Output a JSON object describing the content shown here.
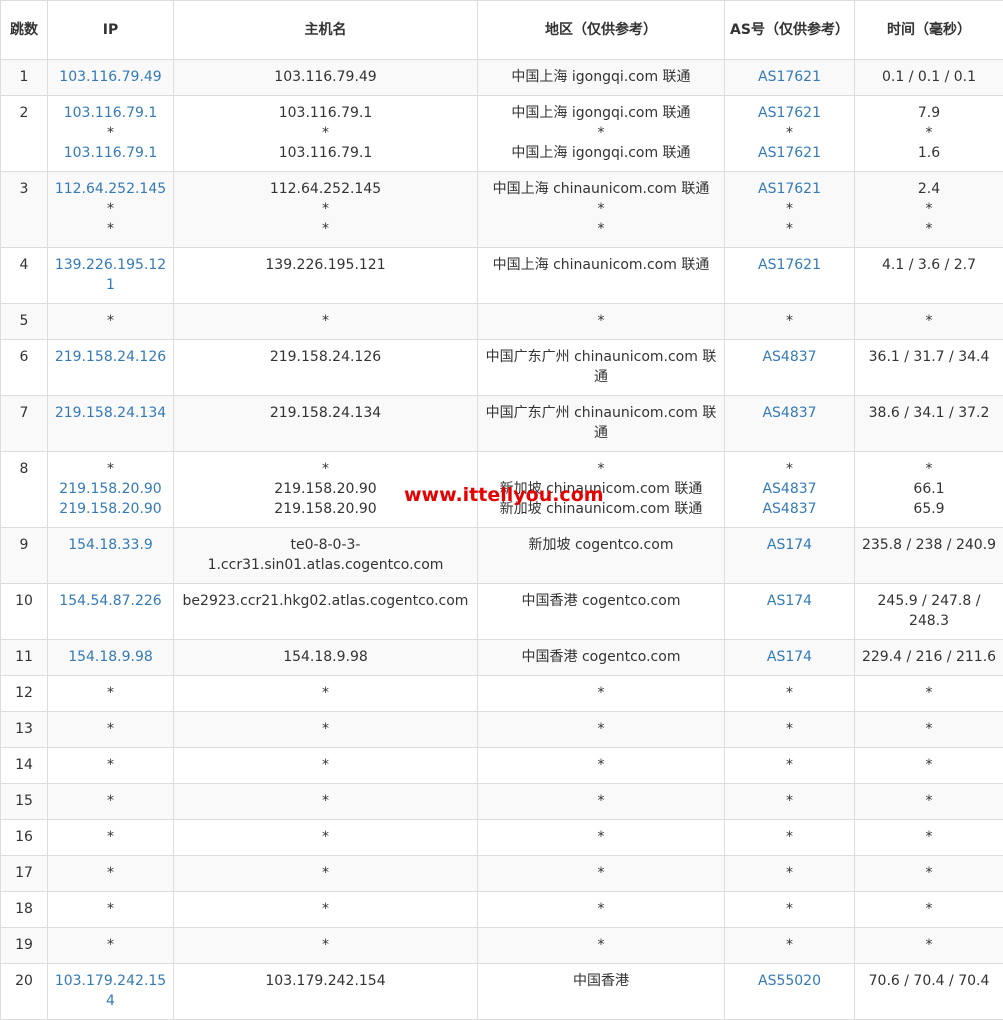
{
  "headers": {
    "hop": "跳数",
    "ip": "IP",
    "host": "主机名",
    "region": "地区（仅供参考）",
    "asn": "AS号（仅供参考）",
    "time": "时间（毫秒）"
  },
  "rows": [
    {
      "hop": "1",
      "ip": [
        "103.116.79.49"
      ],
      "host": [
        "103.116.79.49"
      ],
      "region": [
        "中国上海 igongqi.com 联通"
      ],
      "asn": [
        "AS17621"
      ],
      "time": [
        "0.1 / 0.1 / 0.1"
      ]
    },
    {
      "hop": "2",
      "ip": [
        "103.116.79.1",
        "*",
        "103.116.79.1"
      ],
      "host": [
        "103.116.79.1",
        "*",
        "103.116.79.1"
      ],
      "region": [
        "中国上海 igongqi.com 联通",
        "*",
        "中国上海 igongqi.com 联通"
      ],
      "asn": [
        "AS17621",
        "*",
        "AS17621"
      ],
      "time": [
        "7.9",
        "*",
        "1.6"
      ]
    },
    {
      "hop": "3",
      "ip": [
        "112.64.252.145",
        "*",
        "*"
      ],
      "host": [
        "112.64.252.145",
        "*",
        "*"
      ],
      "region": [
        "中国上海 chinaunicom.com 联通",
        "*",
        "*"
      ],
      "asn": [
        "AS17621",
        "*",
        "*"
      ],
      "time": [
        "2.4",
        "*",
        "*"
      ]
    },
    {
      "hop": "4",
      "ip": [
        "139.226.195.121"
      ],
      "host": [
        "139.226.195.121"
      ],
      "region": [
        "中国上海 chinaunicom.com 联通"
      ],
      "asn": [
        "AS17621"
      ],
      "time": [
        "4.1 / 3.6 / 2.7"
      ]
    },
    {
      "hop": "5",
      "ip": [
        "*"
      ],
      "host": [
        "*"
      ],
      "region": [
        "*"
      ],
      "asn": [
        "*"
      ],
      "time": [
        "*"
      ]
    },
    {
      "hop": "6",
      "ip": [
        "219.158.24.126"
      ],
      "host": [
        "219.158.24.126"
      ],
      "region": [
        "中国广东广州 chinaunicom.com 联通"
      ],
      "asn": [
        "AS4837"
      ],
      "time": [
        "36.1 / 31.7 / 34.4"
      ]
    },
    {
      "hop": "7",
      "ip": [
        "219.158.24.134"
      ],
      "host": [
        "219.158.24.134"
      ],
      "region": [
        "中国广东广州 chinaunicom.com 联通"
      ],
      "asn": [
        "AS4837"
      ],
      "time": [
        "38.6 / 34.1 / 37.2"
      ]
    },
    {
      "hop": "8",
      "ip": [
        "*",
        "219.158.20.90",
        "219.158.20.90"
      ],
      "host": [
        "*",
        "219.158.20.90",
        "219.158.20.90"
      ],
      "region": [
        "*",
        "新加坡 chinaunicom.com 联通",
        "新加坡 chinaunicom.com 联通"
      ],
      "asn": [
        "*",
        "AS4837",
        "AS4837"
      ],
      "time": [
        "*",
        "66.1",
        "65.9"
      ]
    },
    {
      "hop": "9",
      "ip": [
        "154.18.33.9"
      ],
      "host": [
        "te0-8-0-3-1.ccr31.sin01.atlas.cogentco.com"
      ],
      "region": [
        "新加坡 cogentco.com"
      ],
      "asn": [
        "AS174"
      ],
      "time": [
        "235.8 / 238 / 240.9"
      ]
    },
    {
      "hop": "10",
      "ip": [
        "154.54.87.226"
      ],
      "host": [
        "be2923.ccr21.hkg02.atlas.cogentco.com"
      ],
      "region": [
        "中国香港 cogentco.com"
      ],
      "asn": [
        "AS174"
      ],
      "time": [
        "245.9 / 247.8 / 248.3"
      ]
    },
    {
      "hop": "11",
      "ip": [
        "154.18.9.98"
      ],
      "host": [
        "154.18.9.98"
      ],
      "region": [
        "中国香港 cogentco.com"
      ],
      "asn": [
        "AS174"
      ],
      "time": [
        "229.4 / 216 / 211.6"
      ]
    },
    {
      "hop": "12",
      "ip": [
        "*"
      ],
      "host": [
        "*"
      ],
      "region": [
        "*"
      ],
      "asn": [
        "*"
      ],
      "time": [
        "*"
      ]
    },
    {
      "hop": "13",
      "ip": [
        "*"
      ],
      "host": [
        "*"
      ],
      "region": [
        "*"
      ],
      "asn": [
        "*"
      ],
      "time": [
        "*"
      ]
    },
    {
      "hop": "14",
      "ip": [
        "*"
      ],
      "host": [
        "*"
      ],
      "region": [
        "*"
      ],
      "asn": [
        "*"
      ],
      "time": [
        "*"
      ]
    },
    {
      "hop": "15",
      "ip": [
        "*"
      ],
      "host": [
        "*"
      ],
      "region": [
        "*"
      ],
      "asn": [
        "*"
      ],
      "time": [
        "*"
      ]
    },
    {
      "hop": "16",
      "ip": [
        "*"
      ],
      "host": [
        "*"
      ],
      "region": [
        "*"
      ],
      "asn": [
        "*"
      ],
      "time": [
        "*"
      ]
    },
    {
      "hop": "17",
      "ip": [
        "*"
      ],
      "host": [
        "*"
      ],
      "region": [
        "*"
      ],
      "asn": [
        "*"
      ],
      "time": [
        "*"
      ]
    },
    {
      "hop": "18",
      "ip": [
        "*"
      ],
      "host": [
        "*"
      ],
      "region": [
        "*"
      ],
      "asn": [
        "*"
      ],
      "time": [
        "*"
      ]
    },
    {
      "hop": "19",
      "ip": [
        "*"
      ],
      "host": [
        "*"
      ],
      "region": [
        "*"
      ],
      "asn": [
        "*"
      ],
      "time": [
        "*"
      ]
    },
    {
      "hop": "20",
      "ip": [
        "103.179.242.154"
      ],
      "host": [
        "103.179.242.154"
      ],
      "region": [
        "中国香港"
      ],
      "asn": [
        "AS55020"
      ],
      "time": [
        "70.6 / 70.4 / 70.4"
      ]
    }
  ],
  "watermark": "www.ittellyou.com",
  "colors": {
    "link": "#337ab7",
    "watermark": "#e60000",
    "border": "#dddddd",
    "stripe": "#f9f9f9"
  }
}
